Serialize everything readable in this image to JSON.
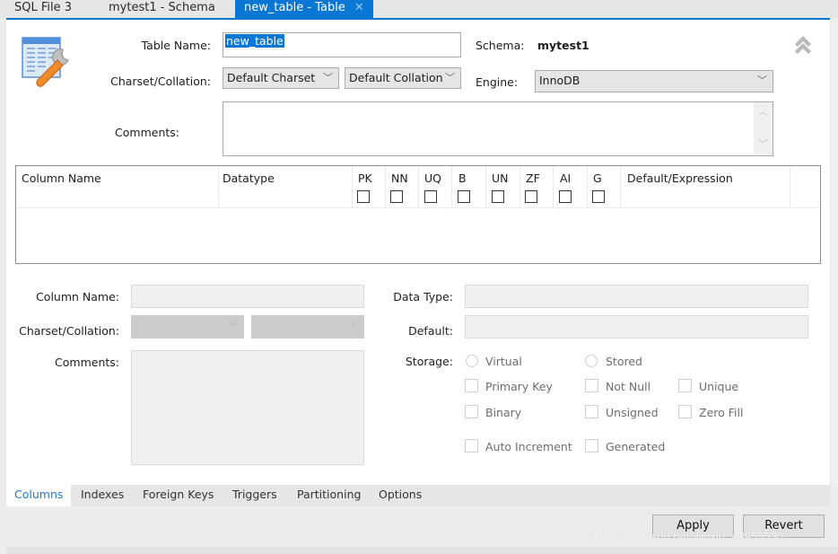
{
  "tabs": [
    {
      "label": "SQL File 3",
      "active": false
    },
    {
      "label": "mytest1 - Schema",
      "active": false
    },
    {
      "label": "new_table - Table",
      "active": true,
      "close_icon": "close-icon"
    }
  ],
  "header": {
    "icon": "table-edit-icon",
    "table_name_label": "Table Name:",
    "table_name_value": "new_table",
    "schema_label": "Schema:",
    "schema_value": "mytest1",
    "charset_label": "Charset/Collation:",
    "charset_value": "Default Charset",
    "collation_value": "Default Collation",
    "engine_label": "Engine:",
    "engine_value": "InnoDB",
    "comments_label": "Comments:",
    "comments_value": "",
    "collapse_icon": "double-chevron-up-icon"
  },
  "grid": {
    "columns": [
      "Column Name",
      "Datatype",
      "PK",
      "NN",
      "UQ",
      "B",
      "UN",
      "ZF",
      "AI",
      "G",
      "Default/Expression"
    ],
    "flag_checkboxes": {
      "PK": false,
      "NN": false,
      "UQ": false,
      "B": false,
      "UN": false,
      "ZF": false,
      "AI": false,
      "G": false
    },
    "rows": []
  },
  "column_details": {
    "column_name_label": "Column Name:",
    "column_name_value": "",
    "charset_label": "Charset/Collation:",
    "charset_value": "",
    "collation_value": "",
    "comments_label": "Comments:",
    "comments_value": "",
    "data_type_label": "Data Type:",
    "data_type_value": "",
    "default_label": "Default:",
    "default_value": "",
    "storage_label": "Storage:",
    "storage_options": [
      {
        "label": "Virtual",
        "selected": false
      },
      {
        "label": "Stored",
        "selected": false
      }
    ],
    "flags": [
      {
        "label": "Primary Key",
        "checked": false
      },
      {
        "label": "Not Null",
        "checked": false
      },
      {
        "label": "Unique",
        "checked": false
      },
      {
        "label": "Binary",
        "checked": false
      },
      {
        "label": "Unsigned",
        "checked": false
      },
      {
        "label": "Zero Fill",
        "checked": false
      },
      {
        "label": "Auto Increment",
        "checked": false
      },
      {
        "label": "Generated",
        "checked": false
      }
    ]
  },
  "subtabs": [
    {
      "label": "Columns",
      "active": true
    },
    {
      "label": "Indexes",
      "active": false
    },
    {
      "label": "Foreign Keys",
      "active": false
    },
    {
      "label": "Triggers",
      "active": false
    },
    {
      "label": "Partitioning",
      "active": false
    },
    {
      "label": "Options",
      "active": false
    }
  ],
  "buttons": {
    "apply": "Apply",
    "revert": "Revert"
  },
  "watermark": "https://blog.csdn.net/weixin_43955530",
  "colors": {
    "accent": "#0a77d5",
    "active_subtab_text": "#1f7ad1"
  }
}
